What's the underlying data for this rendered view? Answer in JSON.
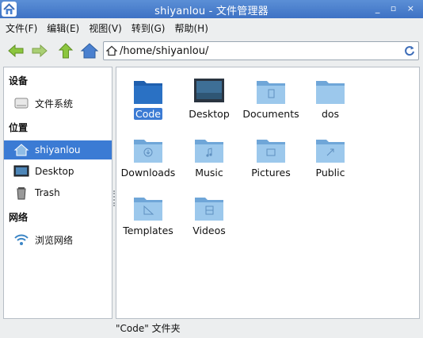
{
  "window": {
    "title": "shiyanlou - 文件管理器",
    "controls": "_ ▫ ×"
  },
  "menu": [
    {
      "label": "文件(F)"
    },
    {
      "label": "编辑(E)"
    },
    {
      "label": "视图(V)"
    },
    {
      "label": "转到(G)"
    },
    {
      "label": "帮助(H)"
    }
  ],
  "toolbar": {
    "icons": [
      "back-arrow-icon",
      "forward-arrow-icon",
      "up-arrow-icon",
      "home-icon"
    ],
    "path": "/home/shiyanlou/"
  },
  "sidebar": {
    "sections": [
      {
        "header": "设备",
        "items": [
          {
            "label": "文件系统",
            "icon": "drive-icon"
          }
        ]
      },
      {
        "header": "位置",
        "items": [
          {
            "label": "shiyanlou",
            "icon": "home-folder-icon",
            "active": true
          },
          {
            "label": "Desktop",
            "icon": "desktop-icon"
          },
          {
            "label": "Trash",
            "icon": "trash-icon"
          }
        ]
      },
      {
        "header": "网络",
        "items": [
          {
            "label": "浏览网络",
            "icon": "wifi-icon"
          }
        ]
      }
    ]
  },
  "files": [
    {
      "name": "Code",
      "icon": "folder-dark-icon",
      "selected": true
    },
    {
      "name": "Desktop",
      "icon": "desktop-folder-icon"
    },
    {
      "name": "Documents",
      "icon": "documents-folder-icon"
    },
    {
      "name": "dos",
      "icon": "folder-icon"
    },
    {
      "name": "Downloads",
      "icon": "downloads-folder-icon"
    },
    {
      "name": "Music",
      "icon": "music-folder-icon"
    },
    {
      "name": "Pictures",
      "icon": "pictures-folder-icon"
    },
    {
      "name": "Public",
      "icon": "public-folder-icon"
    },
    {
      "name": "Templates",
      "icon": "templates-folder-icon"
    },
    {
      "name": "Videos",
      "icon": "videos-folder-icon"
    }
  ],
  "status": "\"Code\" 文件夹",
  "colors": {
    "titlebar": "#4a80cf",
    "selection": "#3b7bd4",
    "folder": "#8fbce6"
  }
}
